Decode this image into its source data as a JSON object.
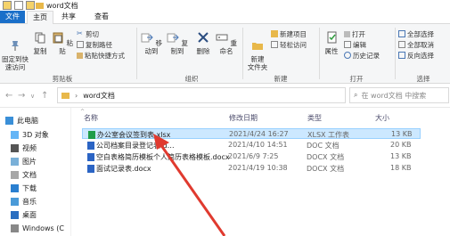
{
  "window": {
    "title": "word文档"
  },
  "tabs": [
    {
      "label": "文件"
    },
    {
      "label": "主页"
    },
    {
      "label": "共享"
    },
    {
      "label": "查看"
    }
  ],
  "ribbon": {
    "pin_quick_access": "固定到快\n速访问",
    "copy": "复制",
    "paste": "粘贴",
    "cut": "剪切",
    "copy_path": "复制路径",
    "paste_shortcut": "粘贴快捷方式",
    "clipboard_group": "剪贴板",
    "move_to": "移动到",
    "copy_to": "复制到",
    "delete": "删除",
    "rename": "重命名",
    "organize_group": "组织",
    "new_folder": "新建\n文件夹",
    "new_item": "新建项目",
    "easy_access": "轻松访问",
    "new_group": "新建",
    "properties": "属性",
    "open": "打开",
    "edit": "编辑",
    "history": "历史记录",
    "open_group": "打开",
    "select_all": "全部选择",
    "select_none": "全部取消",
    "invert_selection": "反向选择",
    "select_group": "选择"
  },
  "address": {
    "path": "word文档",
    "search_placeholder": "在 word文档 中搜索"
  },
  "nav_pane": {
    "items": [
      {
        "label": "此电脑",
        "icon": "pc-icon"
      },
      {
        "label": "3D 对象",
        "icon": "cube-icon"
      },
      {
        "label": "视频",
        "icon": "video-icon"
      },
      {
        "label": "图片",
        "icon": "picture-icon"
      },
      {
        "label": "文档",
        "icon": "document-icon"
      },
      {
        "label": "下载",
        "icon": "download-icon"
      },
      {
        "label": "音乐",
        "icon": "music-icon"
      },
      {
        "label": "桌面",
        "icon": "desktop-icon"
      },
      {
        "label": "Windows (C",
        "icon": "drive-icon"
      }
    ]
  },
  "files": {
    "columns": [
      "名称",
      "修改日期",
      "类型",
      "大小"
    ],
    "rows": [
      {
        "name": "办公室会议签到表.xlsx",
        "date": "2021/4/24 16:27",
        "type": "XLSX 工作表",
        "size": "13 KB",
        "kind": "xlsx",
        "selected": true
      },
      {
        "name": "公司档案目录登记表.d…",
        "date": "2021/4/10 14:51",
        "type": "DOC 文档",
        "size": "20 KB",
        "kind": "doc",
        "selected": false
      },
      {
        "name": "空白表格简历模板个人简历表格模板.docx",
        "date": "2021/6/9 7:25",
        "type": "DOCX 文档",
        "size": "13 KB",
        "kind": "docx",
        "selected": false
      },
      {
        "name": "面试记录表.docx",
        "date": "2021/4/19 10:38",
        "type": "DOCX 文档",
        "size": "18 KB",
        "kind": "docx",
        "selected": false
      }
    ]
  },
  "colors": {
    "accent": "#1a6fc9",
    "selection": "#cce8ff",
    "arrow": "#e03a2f"
  }
}
